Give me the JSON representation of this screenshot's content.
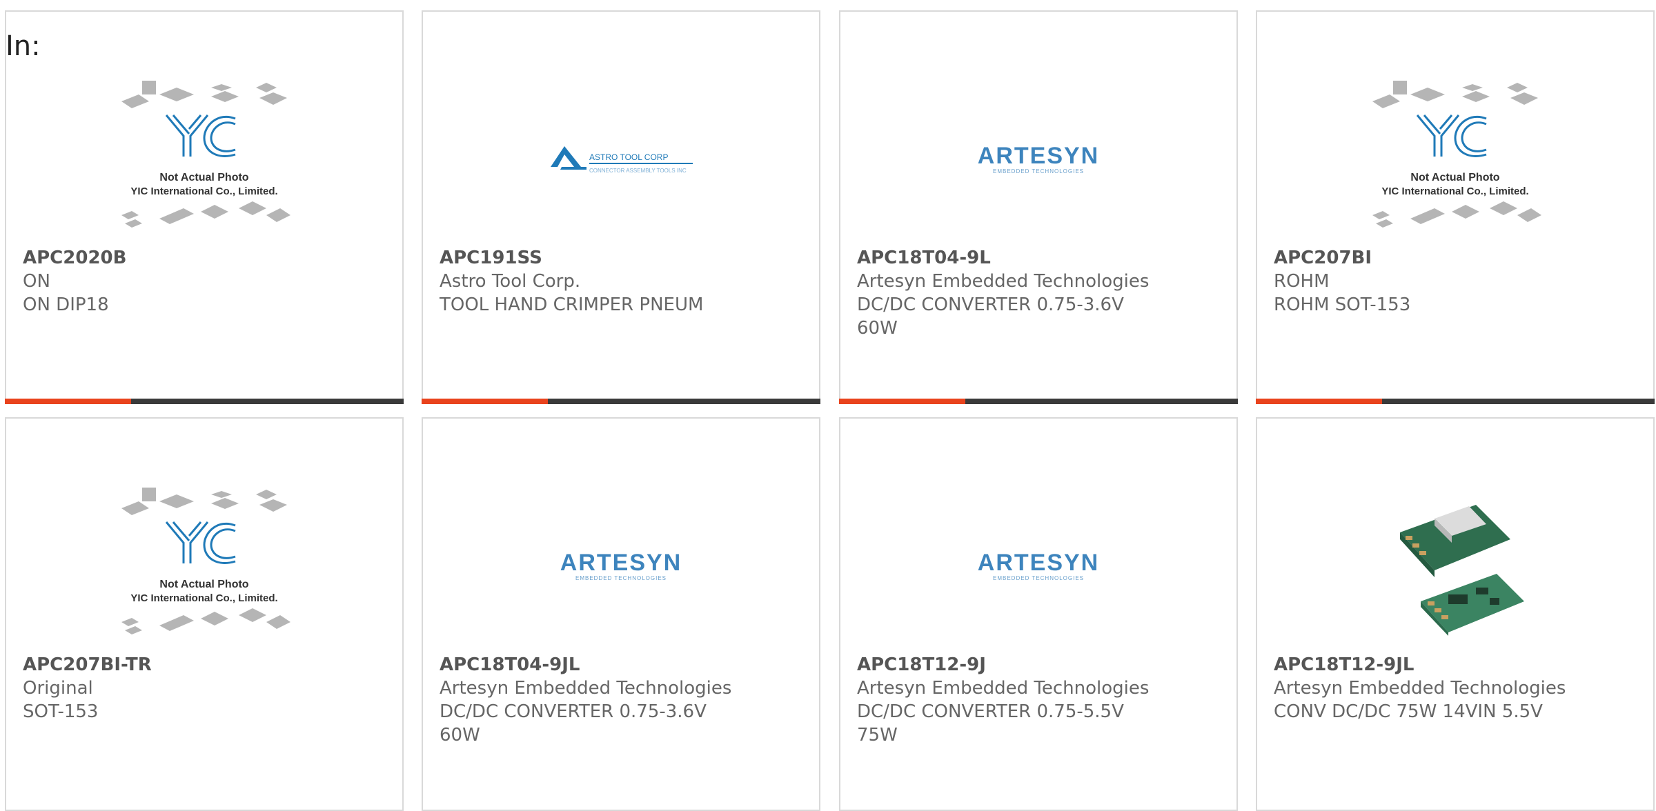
{
  "header": {
    "in_label": "In:"
  },
  "products": [
    {
      "part_number": "APC2020B",
      "manufacturer": "ON",
      "description": "ON DIP18",
      "image": "not-actual-photo"
    },
    {
      "part_number": "APC191SS",
      "manufacturer": "Astro Tool Corp.",
      "description": "TOOL HAND CRIMPER PNEUM",
      "image": "astro-tool-logo"
    },
    {
      "part_number": "APC18T04-9L",
      "manufacturer": "Artesyn Embedded Technologies",
      "description": "DC/DC CONVERTER 0.75-3.6V 60W",
      "image": "artesyn-logo"
    },
    {
      "part_number": "APC207BI",
      "manufacturer": "ROHM",
      "description": "ROHM SOT-153",
      "image": "not-actual-photo"
    },
    {
      "part_number": "APC207BI-TR",
      "manufacturer": "Original",
      "description": "SOT-153",
      "image": "not-actual-photo"
    },
    {
      "part_number": "APC18T04-9JL",
      "manufacturer": "Artesyn Embedded Technologies",
      "description": "DC/DC CONVERTER 0.75-3.6V 60W",
      "image": "artesyn-logo"
    },
    {
      "part_number": "APC18T12-9J",
      "manufacturer": "Artesyn Embedded Technologies",
      "description": "DC/DC CONVERTER 0.75-5.5V 75W",
      "image": "artesyn-logo"
    },
    {
      "part_number": "APC18T12-9JL",
      "manufacturer": "Artesyn Embedded Technologies",
      "description": "CONV DC/DC 75W 14VIN 5.5V",
      "image": "product-photo"
    }
  ],
  "placeholder": {
    "line1": "Not Actual Photo",
    "line2": "YIC International Co., Limited."
  },
  "logos": {
    "astro": "ASTRO TOOL CORP",
    "astro_sub": "CONNECTOR ASSEMBLY TOOLS INC",
    "artesyn": "ARTESYN",
    "artesyn_sub": "EMBEDDED TECHNOLOGIES"
  },
  "colors": {
    "accent": "#e9431d",
    "bar": "#3a3a3a",
    "border": "#d9d9d9",
    "logo_blue": "#1f7ab8"
  }
}
